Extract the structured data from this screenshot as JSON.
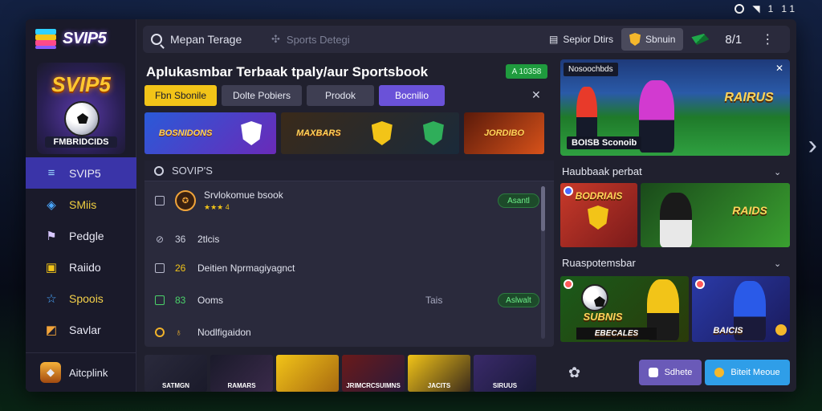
{
  "status_bar": {
    "signal": "1",
    "battery": "1 1"
  },
  "sidebar": {
    "logo_text": "SVIP5",
    "badge_title": "SVIP5",
    "badge_sub": "FMBRIDCIDS",
    "items": [
      {
        "label": "SVIP5",
        "icon": "stack-icon"
      },
      {
        "label": "SMiis",
        "icon": "cube-icon"
      },
      {
        "label": "Pedgle",
        "icon": "flag-icon"
      },
      {
        "label": "Raiido",
        "icon": "lock-icon"
      },
      {
        "label": "Spoois",
        "icon": "star-icon"
      },
      {
        "label": "Savlar",
        "icon": "chart-icon"
      }
    ],
    "footer_label": "Aitcplink"
  },
  "topbar": {
    "search_label": "Mepan Terage",
    "sports_placeholder": "Sports Detegi",
    "spot_label": "Sepior Dtirs",
    "gold_button_label": "Sbnuin",
    "counter": "8/1"
  },
  "main": {
    "headline": "Aplukasmbar Terbaak tpaly/aur Sportsbook",
    "online_badge": "A 10358",
    "tabs": [
      {
        "label": "Fbn Sbonile",
        "style": "gold"
      },
      {
        "label": "Dolte Pobiers",
        "style": "gray"
      },
      {
        "label": "Prodok",
        "style": "gray"
      },
      {
        "label": "Bocnilio",
        "style": "purple"
      }
    ],
    "promos": [
      {
        "text": "BOSNIDONS"
      },
      {
        "text": "MAXBARS"
      },
      {
        "text": ""
      },
      {
        "text": "JORDIBO"
      }
    ],
    "list_search": "SOVIP'S",
    "list_rows": [
      {
        "num": "",
        "label": "Srvlokomue bsook",
        "stars": "★★★ 4",
        "action": "Asantl"
      },
      {
        "num": "36",
        "label": "2tlcis",
        "mid": "",
        "action": ""
      },
      {
        "num": "26",
        "label": "Deitien Nprmagiyagnct",
        "mid": "",
        "action": ""
      },
      {
        "num": "83",
        "label": "Ooms",
        "mid": "Tais",
        "action": "Aslwalt"
      },
      {
        "num": "",
        "label": "Nodlfigaidon",
        "mid": "",
        "action": ""
      }
    ],
    "thumbs": [
      {
        "label": "SATMGN"
      },
      {
        "label": "RAMARS"
      },
      {
        "label": ""
      },
      {
        "label": "JRIMCRCSUIMNS"
      },
      {
        "label": "JACITS"
      },
      {
        "label": "SIRUUS"
      }
    ],
    "btn_left": "Sdhete",
    "btn_right": "Biteit Meoue"
  },
  "right_panel": {
    "hero_label": "Nosoochbds",
    "hero_brand": "RAIRUS",
    "hero_sub": "BOISB Sconoib",
    "section1_title": "Haubbaak perbat",
    "section1_tiles": [
      {
        "text": "BODRIAIS"
      },
      {
        "text": "RAIDS"
      }
    ],
    "section2_title": "Ruaspotemsbar",
    "section2_tiles": [
      {
        "text": "SUBNIS"
      },
      {
        "text": "BAICIS"
      }
    ],
    "section2_tile_sub": "EBECALES"
  }
}
